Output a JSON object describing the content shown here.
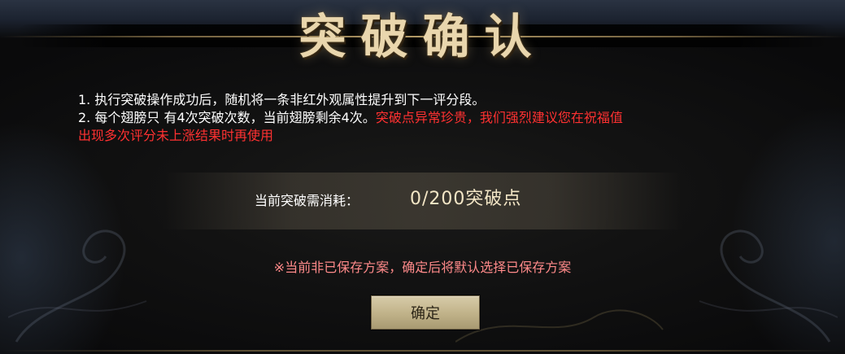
{
  "dialog": {
    "title": "突破确认",
    "rules": {
      "line1": "1.  执行突破操作成功后，随机将一条非红外观属性提升到下一评分段。",
      "line2_white": "2.   每个翅膀只 有4次突破次数，当前翅膀剩余4次。",
      "line2_red": "突破点异常珍贵，我们强烈建议您在祝福值",
      "line3_red": "出现多次评分未上涨结果时再使用"
    },
    "cost": {
      "label": "当前突破需消耗：",
      "value": "0/200突破点"
    },
    "notice": "※当前非已保存方案，确定后将默认选择已保存方案",
    "confirm_label": "确定"
  },
  "colors": {
    "warning_red": "#ff3131",
    "notice_pink": "#ff8a8a",
    "title_gold": "#e9d6ad",
    "button_gold": "#c2b48b"
  }
}
